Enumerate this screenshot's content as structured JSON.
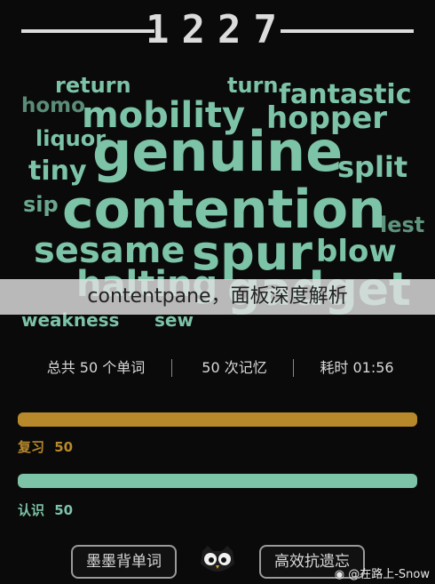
{
  "header": {
    "count": "1227"
  },
  "cloud": {
    "words": [
      "return",
      "turn",
      "fantastic",
      "homo",
      "mobility",
      "hopper",
      "liquor",
      "genuine",
      "tiny",
      "split",
      "sip",
      "contention",
      "lest",
      "sesame",
      "spur",
      "blow",
      "halting",
      "gadget",
      "weakness",
      "sew"
    ]
  },
  "overlay": {
    "text": "contentpane，面板深度解析"
  },
  "stats": {
    "total": "总共 50 个单词",
    "memorized": "50 次记忆",
    "time": "耗时 01:56"
  },
  "progress": {
    "review": {
      "label": "复习",
      "value": "50",
      "fraction": 1.0,
      "color": "#b8892a"
    },
    "recognize": {
      "label": "认识",
      "value": "50",
      "fraction": 1.0,
      "color": "#7cc3a7"
    }
  },
  "buttons": {
    "left": "墨墨背单词",
    "right": "高效抗遗忘"
  },
  "watermark": "@在路上-Snow",
  "colors": {
    "word": "#7cc3a7",
    "review": "#b8892a",
    "recognize": "#7cc3a7",
    "background": "#0a0a0a"
  }
}
